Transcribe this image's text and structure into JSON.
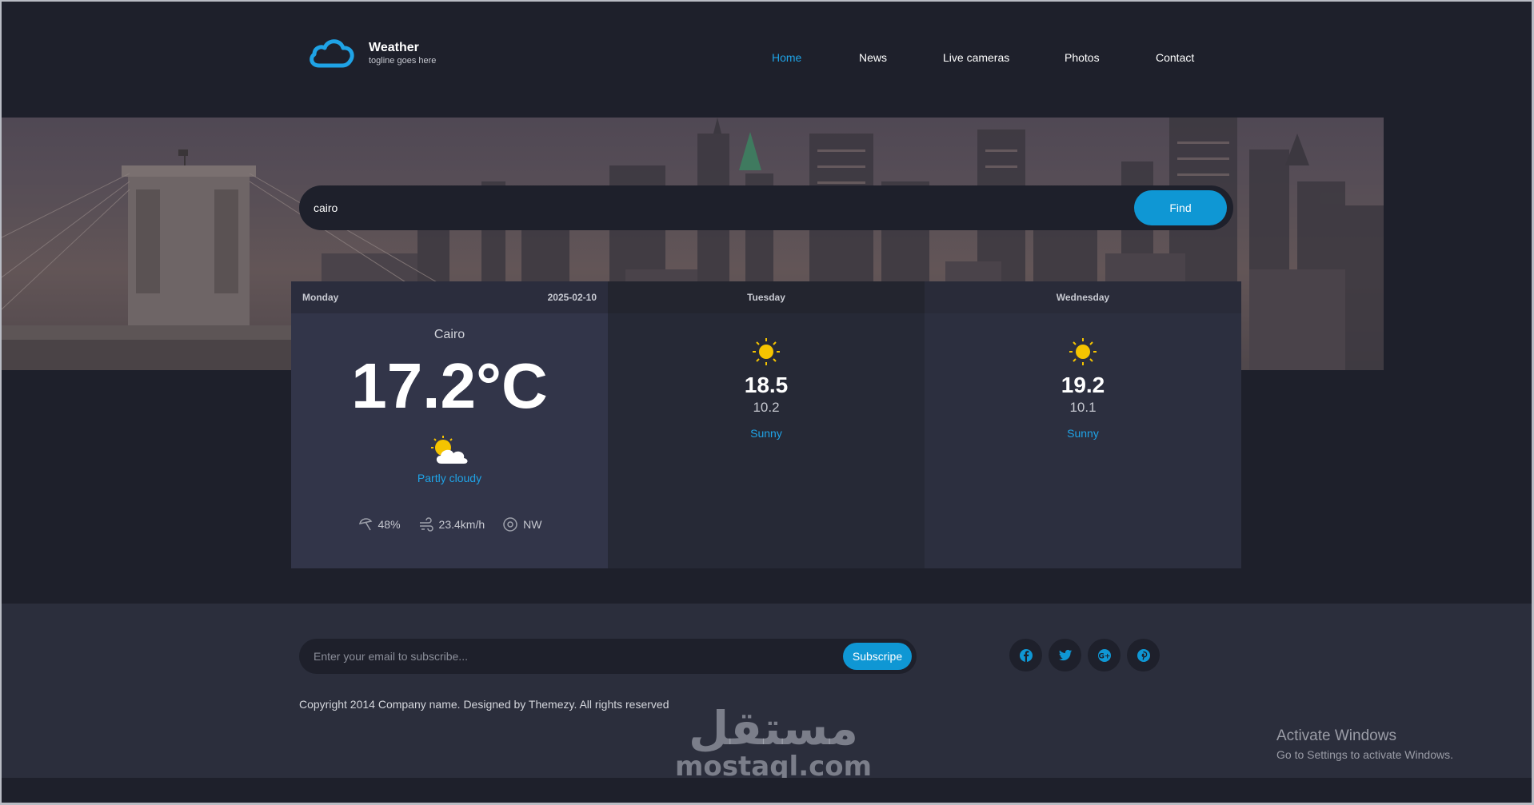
{
  "brand": {
    "title": "Weather",
    "tagline": "togline goes here",
    "logo_icon": "cloud-icon"
  },
  "nav": {
    "items": [
      {
        "label": "Home",
        "active": true
      },
      {
        "label": "News",
        "active": false
      },
      {
        "label": "Live cameras",
        "active": false
      },
      {
        "label": "Photos",
        "active": false
      },
      {
        "label": "Contact",
        "active": false
      }
    ]
  },
  "search": {
    "value": "cairo",
    "button_label": "Find"
  },
  "forecast": {
    "today": {
      "day": "Monday",
      "date": "2025-02-10",
      "city": "Cairo",
      "temp": "17.2°C",
      "icon": "partly-cloudy-icon",
      "condition": "Partly cloudy",
      "humidity": "48%",
      "wind_speed": "23.4km/h",
      "wind_dir": "NW"
    },
    "days": [
      {
        "day": "Tuesday",
        "icon": "sun-icon",
        "max": "18.5",
        "min": "10.2",
        "condition": "Sunny"
      },
      {
        "day": "Wednesday",
        "icon": "sun-icon",
        "max": "19.2",
        "min": "10.1",
        "condition": "Sunny"
      }
    ]
  },
  "footer": {
    "subscribe_placeholder": "Enter your email to subscribe...",
    "subscribe_label": "Subscripe",
    "socials": [
      "facebook-icon",
      "twitter-icon",
      "google-plus-icon",
      "pinterest-icon"
    ],
    "copyright": "Copyright 2014 Company name. Designed by Themezy. All rights reserved"
  },
  "watermark": {
    "arabic": "مستقل",
    "latin": "mostaql.com"
  },
  "os_notice": {
    "title": "Activate Windows",
    "subtitle": "Go to Settings to activate Windows."
  },
  "colors": {
    "accent": "#0f97d4",
    "link": "#1fa3e6",
    "background": "#1e202b",
    "card": "#323549",
    "sun": "#f5c400"
  }
}
